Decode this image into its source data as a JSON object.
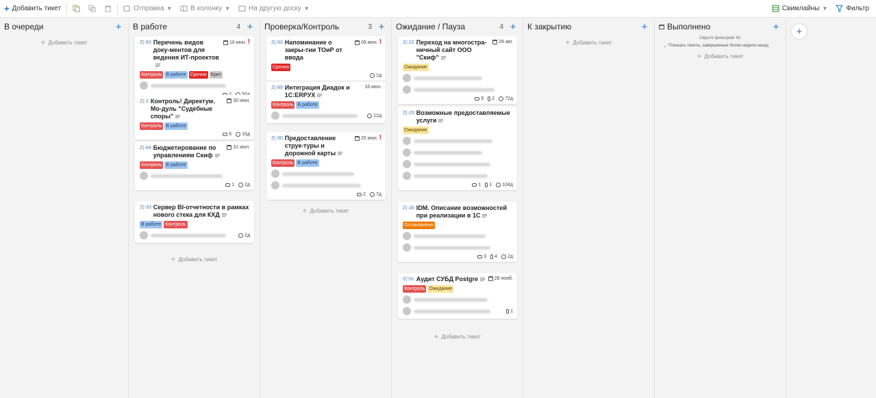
{
  "toolbar": {
    "add_ticket": "Добавить тикет",
    "send": "Отправка",
    "to_column": "В колонку",
    "to_board": "На другую доску",
    "swimlanes": "Свимлайны",
    "filter": "Фильтр"
  },
  "add_ticket_label": "Добавить тикет",
  "columns": [
    {
      "title": "В очереди",
      "count": ""
    },
    {
      "title": "В работе",
      "count": "4"
    },
    {
      "title": "Проверка/Контроль",
      "count": "3"
    },
    {
      "title": "Ожидание / Пауза",
      "count": "4"
    },
    {
      "title": "К закрытию",
      "count": ""
    },
    {
      "title": "Выполнено",
      "count": "",
      "hidden_note": "Скрыто фильтром: 81",
      "show_old": "Показать тикеты, завершенные более недели назад"
    }
  ],
  "cards": {
    "c83": {
      "id": "Z(-83",
      "title": "Перечень видов доку-ментов для ведения ИТ-проектов",
      "date": "16 июн.",
      "tags": [
        "Контроль",
        "В работе",
        "Срочно",
        "Крит"
      ],
      "comments": "2",
      "time": "55д"
    },
    "c2": {
      "id": "Z(-2",
      "title": "Контроль! Директум. Мо-дуль \"Судебные споры\"",
      "date": "30 июн.",
      "tags": [
        "Контроль",
        "В работе"
      ],
      "comments": "6",
      "time": "16д"
    },
    "c84": {
      "id": "Z(-84",
      "title": "Бюджетирование по управлениям Скиф",
      "date": "31 июл.",
      "tags": [
        "Контроль",
        "В работе"
      ],
      "comments": "1",
      "time": "2д"
    },
    "c33": {
      "id": "Z(-33",
      "title": "Сервер BI-отчетности в рамках нового стека для КХД",
      "tags": [
        "В работе",
        "Контроль"
      ],
      "time": "2д"
    },
    "c93": {
      "id": "Z(-93",
      "title": "Напоминание о закры-тии ТОиР от ввода",
      "date": "09 июн.",
      "tags": [
        "Срочно"
      ],
      "time": "1д"
    },
    "c89": {
      "id": "Z(-89",
      "title": "Интеграция Диадок и 1С:ERPУХ",
      "date": "16 июн.",
      "tags": [
        "Контроль",
        "В работе"
      ],
      "time": "12д"
    },
    "c90": {
      "id": "Z(-90",
      "title": "Предоставление струк-туры и дорожной карты",
      "date": "20 июн.",
      "tags": [
        "Контроль",
        "В работе"
      ],
      "comments": "2",
      "time": "7д"
    },
    "c22": {
      "id": "Z(-22",
      "title": "Переход на многостра-ничный сайт ООО \"Скиф\"",
      "date": "29 авг.",
      "tags": [
        "Ожидание"
      ],
      "comments": "6",
      "attachments": "2",
      "time": "72д"
    },
    "c23": {
      "id": "Z(-23",
      "title": "Возможные предоставляемые услуги",
      "tags": [
        "Ожидание"
      ],
      "comments": "1",
      "attachments": "1",
      "time": "104д"
    },
    "c28": {
      "id": "Z(-28",
      "title": "IDM. Описание возможностей при реализации в 1С",
      "tags": [
        "Остановлено"
      ],
      "comments": "3",
      "attachments": "4",
      "time": "2д"
    },
    "c91": {
      "id": "Z(-91",
      "title": "Аудит СУБД Postgre",
      "date": "28 нояб.",
      "tags": [
        "Контроль",
        "Ожидание"
      ],
      "attachments": "1"
    }
  }
}
